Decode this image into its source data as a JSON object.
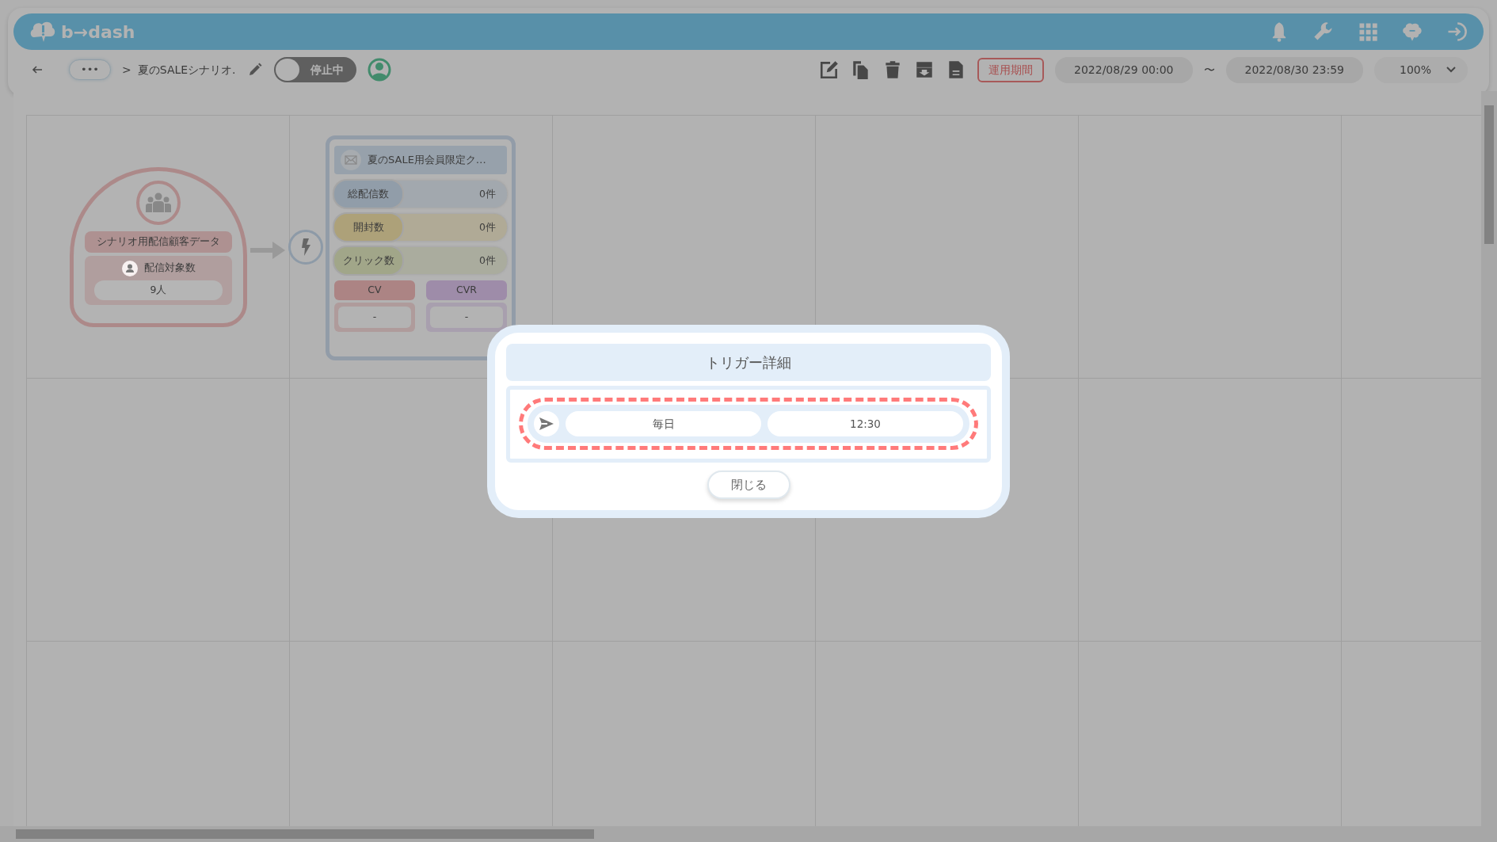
{
  "header": {
    "logo": "b→dash"
  },
  "toolbar": {
    "more": "•••",
    "separator": ">",
    "scenario_name": "夏のSALEシナリオ.",
    "toggle": {
      "label": "停止中",
      "on": false
    },
    "period_button": "運用期間",
    "start": "2022/08/29 00:00",
    "tilde": "〜",
    "end": "2022/08/30 23:59",
    "zoom": "100%"
  },
  "canvas": {
    "segment_node": {
      "title": "シナリオ用配信顧客データ",
      "count_label": "配信対象数",
      "count": "9人"
    },
    "mail_node": {
      "title": "夏のSALE用会員限定ク…",
      "stats": [
        {
          "label": "総配信数",
          "value": "0件",
          "color": "#919da9"
        },
        {
          "label": "開封数",
          "value": "0件",
          "color": "#ada179"
        },
        {
          "label": "クリック数",
          "value": "0件",
          "color": "#a1a689"
        }
      ],
      "metrics": [
        {
          "label": "CV",
          "value": "-",
          "color": "#ac8484"
        },
        {
          "label": "CVR",
          "value": "-",
          "color": "#9e8ca9"
        }
      ]
    }
  },
  "modal": {
    "title": "トリガー詳細",
    "frequency": "毎日",
    "time": "12:30",
    "highlighted": true,
    "close_button": "閉じる"
  }
}
